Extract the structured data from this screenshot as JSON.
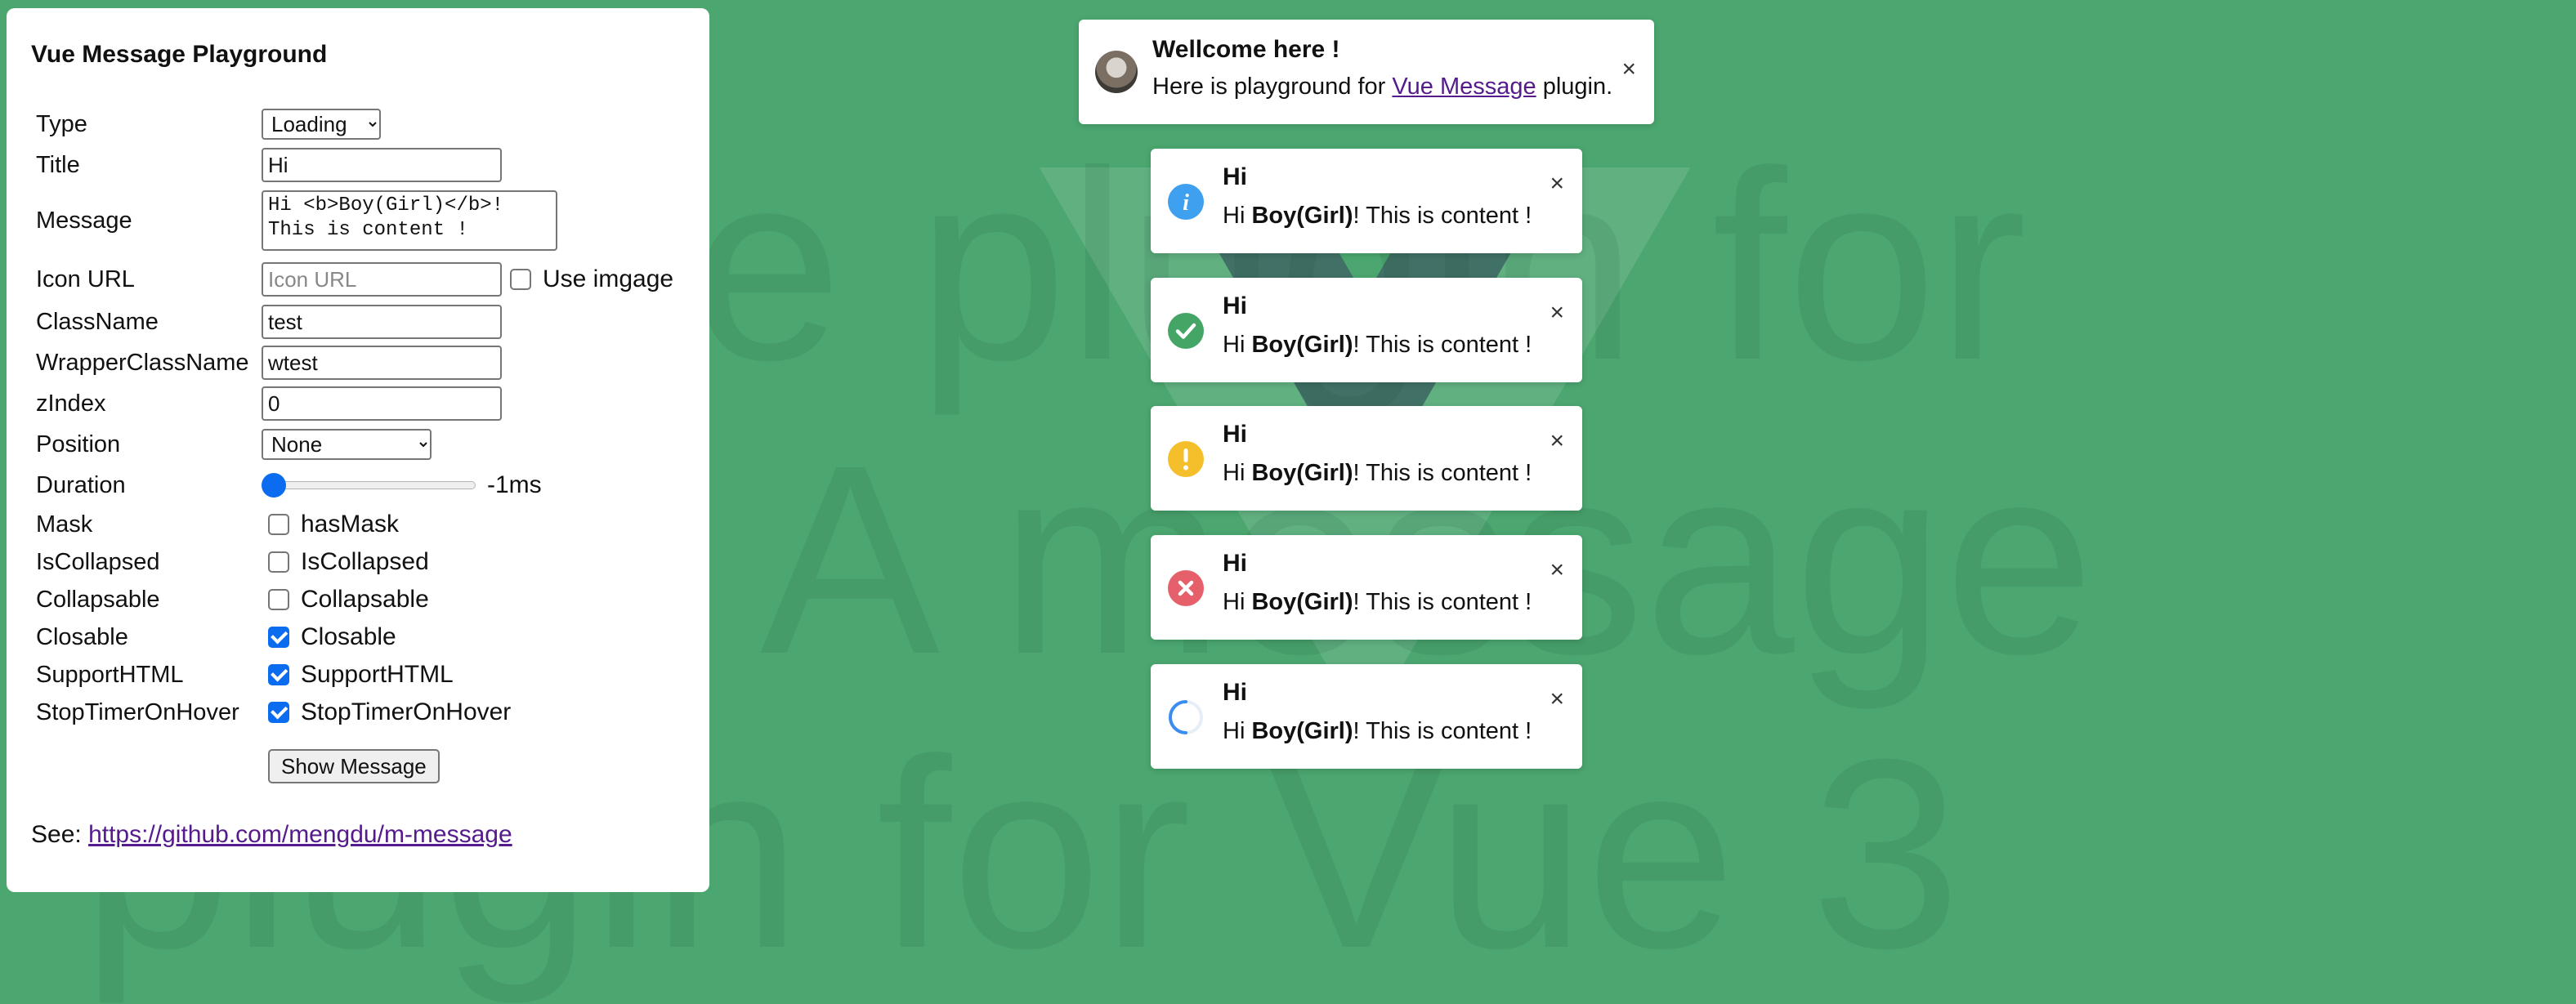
{
  "background": {
    "line1": "ssage plugin for",
    "line2": "A message",
    "line3": "plugin for Vue 3",
    "color": "#4ba66f"
  },
  "panel": {
    "title": "Vue Message Playground",
    "fields": {
      "type": {
        "label": "Type",
        "value": "Loading"
      },
      "title": {
        "label": "Title",
        "value": "Hi"
      },
      "message": {
        "label": "Message",
        "value": "Hi <b>Boy(Girl)</b>!\nThis is content !"
      },
      "icon_url": {
        "label": "Icon URL",
        "placeholder": "Icon URL",
        "checkbox_label": "Use imgage"
      },
      "class_name": {
        "label": "ClassName",
        "value": "test"
      },
      "wrapper_class_name": {
        "label": "WrapperClassName",
        "value": "wtest"
      },
      "z_index": {
        "label": "zIndex",
        "value": "0"
      },
      "position": {
        "label": "Position",
        "value": "None"
      },
      "duration": {
        "label": "Duration",
        "value_text": "-1ms"
      },
      "mask": {
        "label": "Mask",
        "checkbox_label": "hasMask",
        "checked": false
      },
      "is_collapsed": {
        "label": "IsCollapsed",
        "checkbox_label": "IsCollapsed",
        "checked": false
      },
      "collapsable": {
        "label": "Collapsable",
        "checkbox_label": "Collapsable",
        "checked": false
      },
      "closable": {
        "label": "Closable",
        "checkbox_label": "Closable",
        "checked": true
      },
      "support_html": {
        "label": "SupportHTML",
        "checkbox_label": "SupportHTML",
        "checked": true
      },
      "stop_timer": {
        "label": "StopTimerOnHover",
        "checkbox_label": "StopTimerOnHover",
        "checked": true
      }
    },
    "show_button": "Show Message",
    "see_label": "See:",
    "see_link": "https://github.com/mengdu/m-message"
  },
  "welcome": {
    "title": "Wellcome here !",
    "text_before": "Here is playground for",
    "link": "Vue Message",
    "text_after": "plugin.",
    "close": "×"
  },
  "toasts": [
    {
      "type": "info",
      "icon": "info-icon",
      "color": "#3fa0ef",
      "title": "Hi",
      "pre": "Hi",
      "bold": "Boy(Girl)",
      "post": "! This is content !",
      "close": "×"
    },
    {
      "type": "success",
      "icon": "check-icon",
      "color": "#44a566",
      "title": "Hi",
      "pre": "Hi",
      "bold": "Boy(Girl)",
      "post": "! This is content !",
      "close": "×"
    },
    {
      "type": "warning",
      "icon": "warning-icon",
      "color": "#f5be2b",
      "title": "Hi",
      "pre": "Hi",
      "bold": "Boy(Girl)",
      "post": "! This is content !",
      "close": "×"
    },
    {
      "type": "error",
      "icon": "error-icon",
      "color": "#e5606a",
      "title": "Hi",
      "pre": "Hi",
      "bold": "Boy(Girl)",
      "post": "! This is content !",
      "close": "×"
    },
    {
      "type": "loading",
      "icon": "loading-spinner-icon",
      "color": "#3b8ef0",
      "title": "Hi",
      "pre": "Hi",
      "bold": "Boy(Girl)",
      "post": "! This is content !",
      "close": "×"
    }
  ]
}
